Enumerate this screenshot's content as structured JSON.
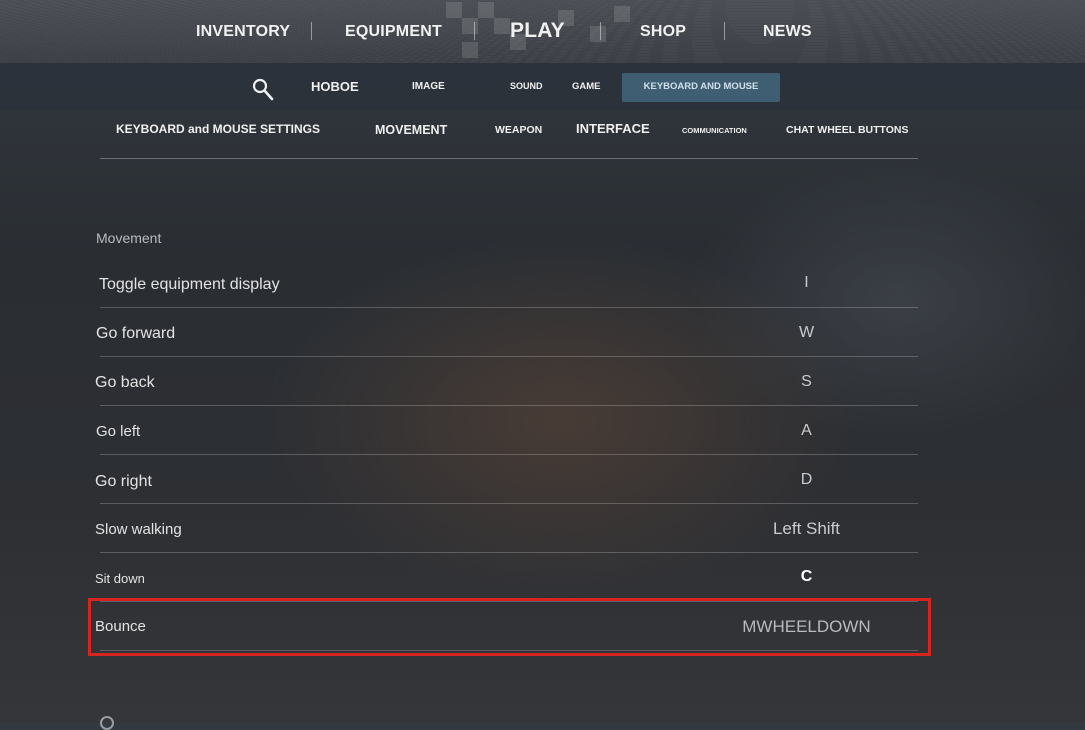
{
  "top_nav": {
    "items": [
      "INVENTORY",
      "EQUIPMENT",
      "PLAY",
      "SHOP",
      "NEWS"
    ],
    "active": "PLAY"
  },
  "sub_nav": {
    "items": [
      "HOBOE",
      "IMAGE",
      "SOUND",
      "GAME"
    ],
    "active_label": "KEYBOARD AND MOUSE"
  },
  "categories": [
    "KEYBOARD and MOUSE SETTINGS",
    "MOVEMENT",
    "WEAPON",
    "INTERFACE",
    "COMMUNICATION",
    "CHAT WHEEL BUTTONS"
  ],
  "section": {
    "title": "Movement",
    "rows": [
      {
        "action": "Toggle equipment display",
        "key": "I"
      },
      {
        "action": "Go forward",
        "key": "W"
      },
      {
        "action": "Go back",
        "key": "S"
      },
      {
        "action": "Go left",
        "key": "A"
      },
      {
        "action": "Go right",
        "key": "D"
      },
      {
        "action": "Slow walking",
        "key": "Left Shift"
      },
      {
        "action": "Sit down",
        "key": "C"
      },
      {
        "action": "Bounce",
        "key": "MWHEELDOWN"
      }
    ]
  },
  "colors": {
    "highlight": "#d6251e",
    "active_tab": "#3f5e72"
  }
}
